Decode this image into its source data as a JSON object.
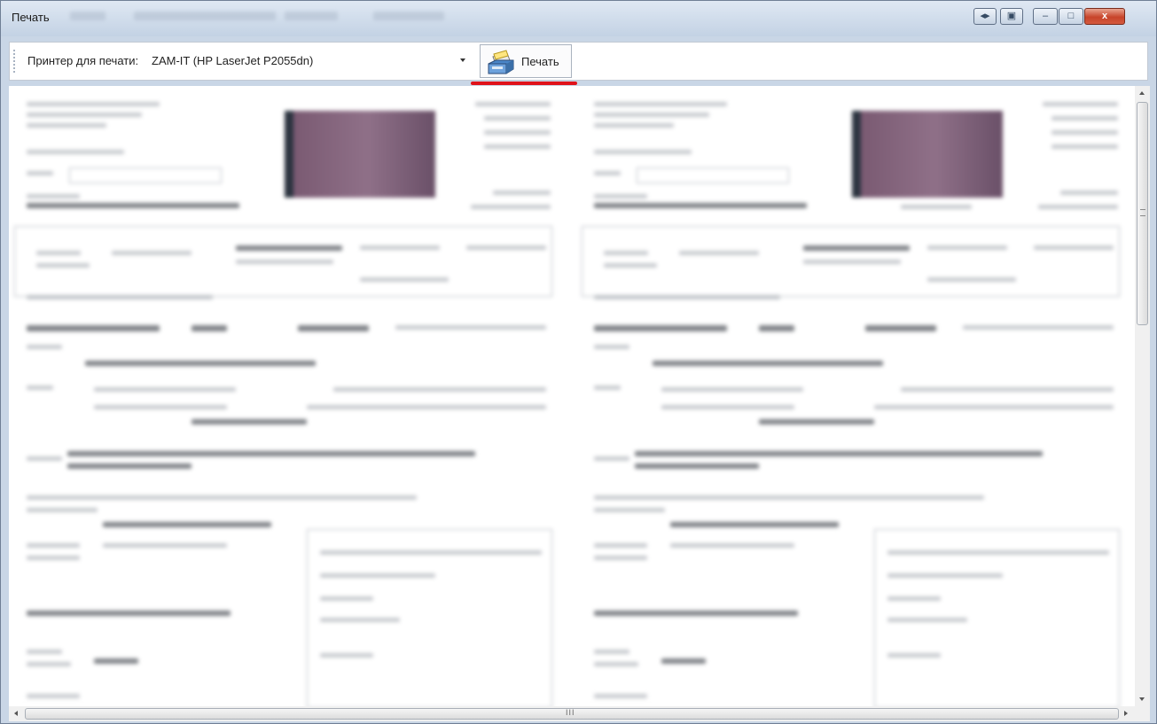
{
  "window": {
    "title": "Печать"
  },
  "toolbar": {
    "printer_label": "Принтер для печати:",
    "printer_value": "ZAM-IT (HP LaserJet P2055dn)",
    "print_button_label": "Печать"
  },
  "hscroll": {
    "grip": "III"
  },
  "colors": {
    "highlight_underline": "#e0121a",
    "titlebar": "#c9d6e6"
  }
}
